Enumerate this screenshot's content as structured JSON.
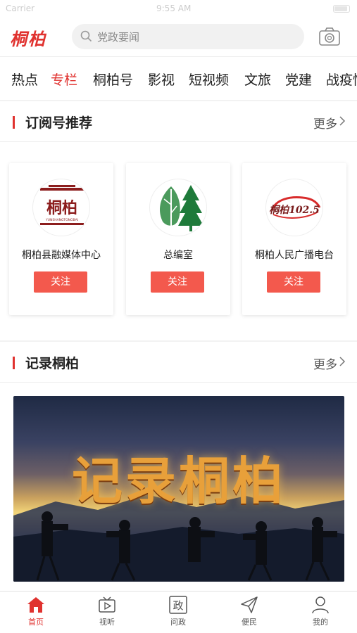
{
  "statusbar": {
    "carrier": "Carrier",
    "time": "9:55 AM"
  },
  "header": {
    "logo": "桐柏",
    "search_placeholder": "党政要闻"
  },
  "tabs": [
    {
      "label": "热点"
    },
    {
      "label": "专栏"
    },
    {
      "label": "桐柏号"
    },
    {
      "label": "影视"
    },
    {
      "label": "短视频"
    },
    {
      "label": "文旅"
    },
    {
      "label": "党建"
    },
    {
      "label": "战疫情"
    }
  ],
  "subscriptions": {
    "title": "订阅号推荐",
    "more": "更多",
    "cards": [
      {
        "name": "桐柏县融媒体中心",
        "avatar_text": "桐柏",
        "avatar_sub": "YUNSHANGTONGBAI",
        "follow": "关注"
      },
      {
        "name": "总编室",
        "follow": "关注"
      },
      {
        "name": "桐柏人民广播电台",
        "avatar_text": "桐柏102.5",
        "follow": "关注"
      }
    ]
  },
  "record": {
    "title": "记录桐柏",
    "more": "更多",
    "banner_text": "记录桐柏"
  },
  "bottom_nav": [
    {
      "label": "首页",
      "icon": "home-icon"
    },
    {
      "label": "视听",
      "icon": "tv-icon"
    },
    {
      "label": "问政",
      "icon": "zheng-icon",
      "glyph": "政"
    },
    {
      "label": "便民",
      "icon": "send-icon"
    },
    {
      "label": "我的",
      "icon": "user-icon"
    }
  ],
  "colors": {
    "accent": "#e0322f",
    "follow_button": "#f3594d"
  }
}
